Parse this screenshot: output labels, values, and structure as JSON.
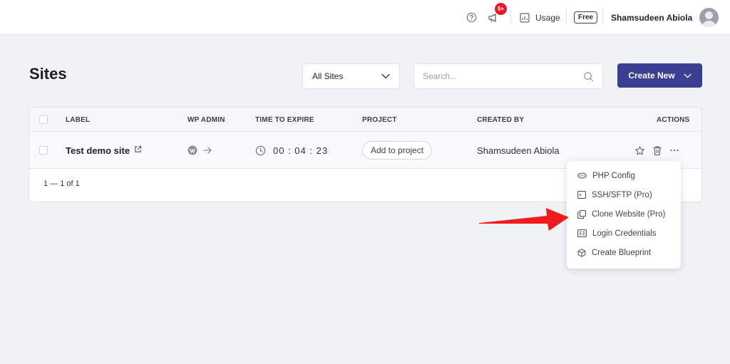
{
  "header": {
    "notification_badge": "9+",
    "usage_label": "Usage",
    "plan_label": "Free",
    "user_name": "Shamsudeen Abiola"
  },
  "page": {
    "title": "Sites",
    "filter_value": "All Sites",
    "search_placeholder": "Search...",
    "create_button": "Create New"
  },
  "table": {
    "columns": [
      "LABEL",
      "WP ADMIN",
      "TIME TO EXPIRE",
      "PROJECT",
      "CREATED BY",
      "ACTIONS"
    ],
    "rows": [
      {
        "label": "Test demo site",
        "time_to_expire": "00 : 04 : 23",
        "project_button": "Add to project",
        "created_by": "Shamsudeen Abiola"
      }
    ],
    "pagination": "1 — 1 of 1"
  },
  "actions_menu": {
    "items": [
      {
        "label": "PHP Config",
        "icon": "php-icon"
      },
      {
        "label": "SSH/SFTP (Pro)",
        "icon": "terminal-icon"
      },
      {
        "label": "Clone Website (Pro)",
        "icon": "clone-icon"
      },
      {
        "label": "Login Credentials",
        "icon": "credentials-icon"
      },
      {
        "label": "Create Blueprint",
        "icon": "cube-icon"
      }
    ]
  },
  "colors": {
    "primary": "#3b3f91",
    "badge": "#e01d2c",
    "arrow": "#ee1c1c"
  }
}
